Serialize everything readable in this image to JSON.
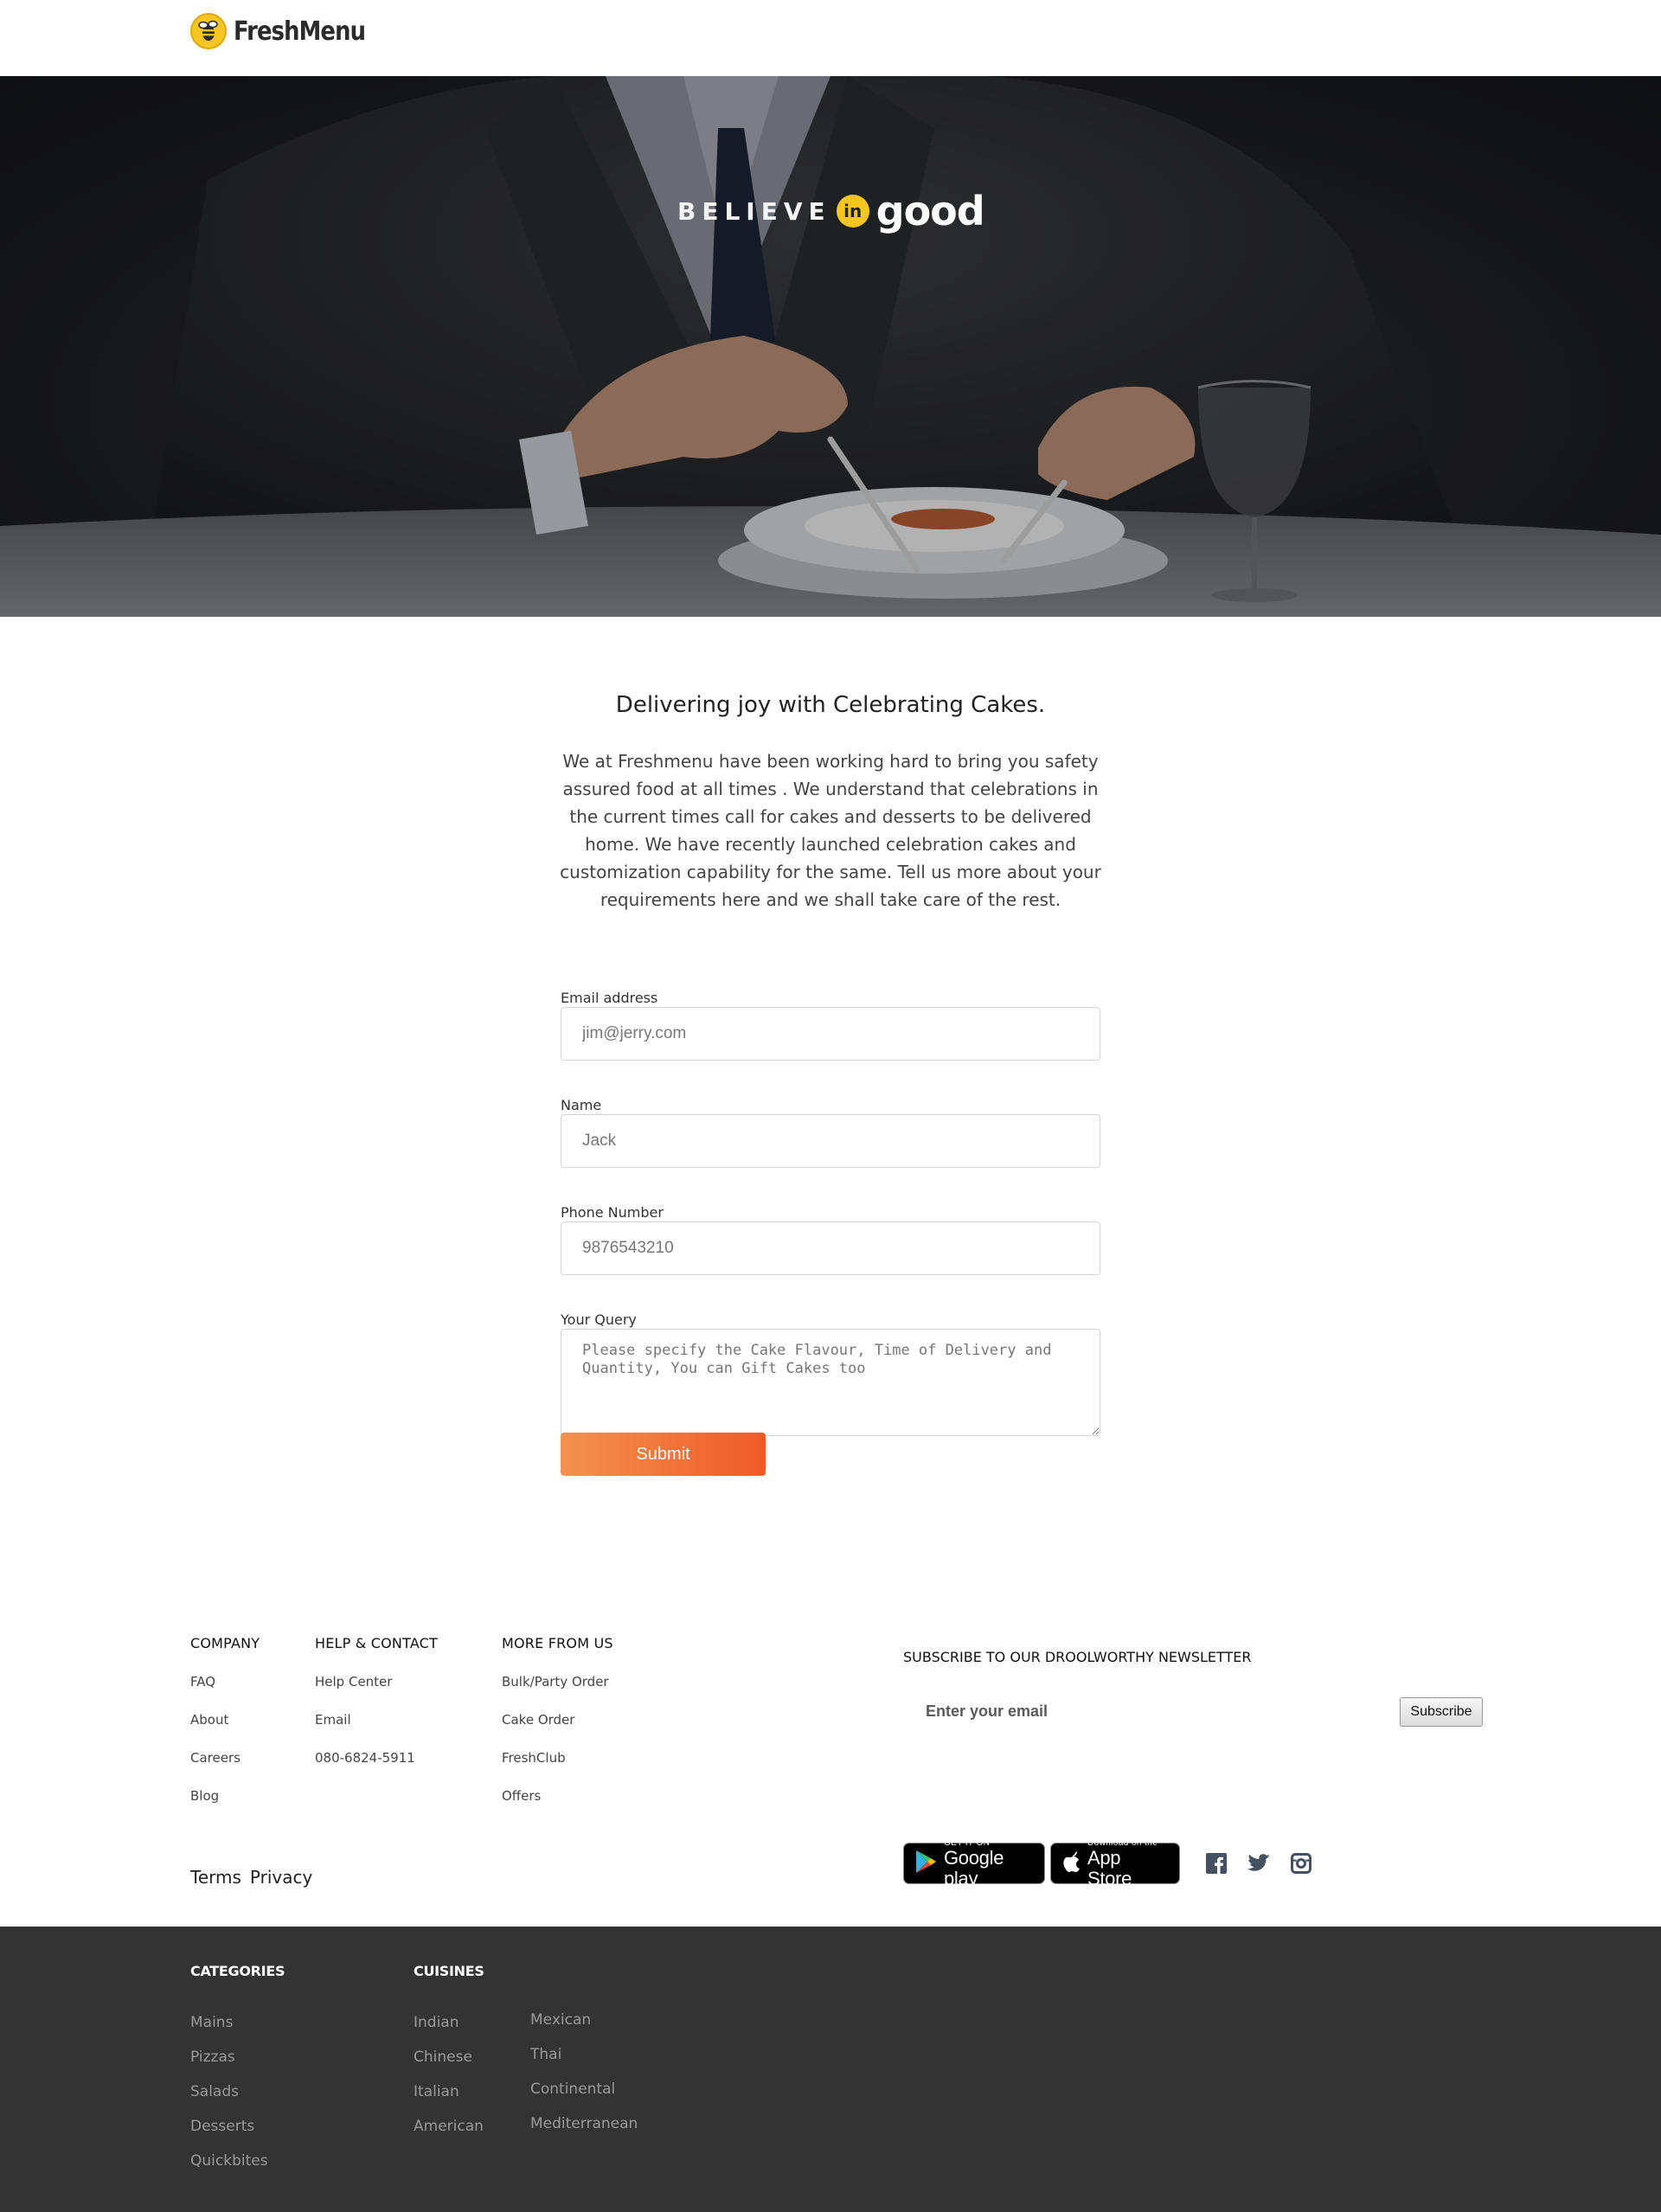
{
  "brand": {
    "name": "FreshMenu",
    "logo_color": "#f7c521"
  },
  "hero": {
    "tagline_believe": "BELIEVE",
    "tagline_in": "in",
    "tagline_good": "good",
    "accent": "#f6c61f"
  },
  "intro": {
    "title": "Delivering joy with Celebrating Cakes.",
    "body": "We at Freshmenu have been working hard to bring you safety assured food at all times . We understand that celebrations in the current times call for cakes and desserts to be delivered home. We have recently launched celebration cakes and customization capability for the same. Tell us more about your requirements here and we shall take care of the rest."
  },
  "form": {
    "email_label": "Email address",
    "email_placeholder": "jim@jerry.com",
    "name_label": "Name",
    "name_placeholder": "Jack",
    "phone_label": "Phone Number",
    "phone_placeholder": "9876543210",
    "query_label": "Your Query",
    "query_placeholder": "Please specify the Cake Flavour, Time of Delivery and Quantity, You can Gift Cakes too",
    "submit_label": "Submit",
    "submit_color_start": "#f3934f",
    "submit_color_end": "#ee5a2a"
  },
  "footer": {
    "company": {
      "title": "COMPANY",
      "links": [
        "FAQ",
        "About",
        "Careers",
        "Blog"
      ]
    },
    "help": {
      "title": "HELP & CONTACT",
      "links": [
        "Help Center",
        "Email",
        "080-6824-5911"
      ]
    },
    "more": {
      "title": "MORE FROM US",
      "links": [
        "Bulk/Party Order",
        "Cake Order",
        "FreshClub",
        "Offers"
      ]
    },
    "newsletter": {
      "title": "SUBSCRIBE TO OUR DROOLWORTHY NEWSLETTER",
      "placeholder": "Enter your email",
      "button": "Subscribe"
    },
    "legal": {
      "terms": "Terms",
      "privacy": "Privacy"
    },
    "stores": {
      "google_small": "GET IT ON",
      "google_big": "Google play",
      "apple_small": "Download on the",
      "apple_big": "App Store"
    },
    "social_icons": [
      "facebook-icon",
      "twitter-icon",
      "instagram-icon"
    ]
  },
  "dark_footer": {
    "background": "#333333",
    "categories": {
      "title": "CATEGORIES",
      "items": [
        "Mains",
        "Pizzas",
        "Salads",
        "Desserts",
        "Quickbites"
      ]
    },
    "cuisines": {
      "title": "CUISINES",
      "col1": [
        "Indian",
        "Chinese",
        "Italian",
        "American"
      ],
      "col2": [
        "Mexican",
        "Thai",
        "Continental",
        "Mediterranean"
      ]
    }
  }
}
